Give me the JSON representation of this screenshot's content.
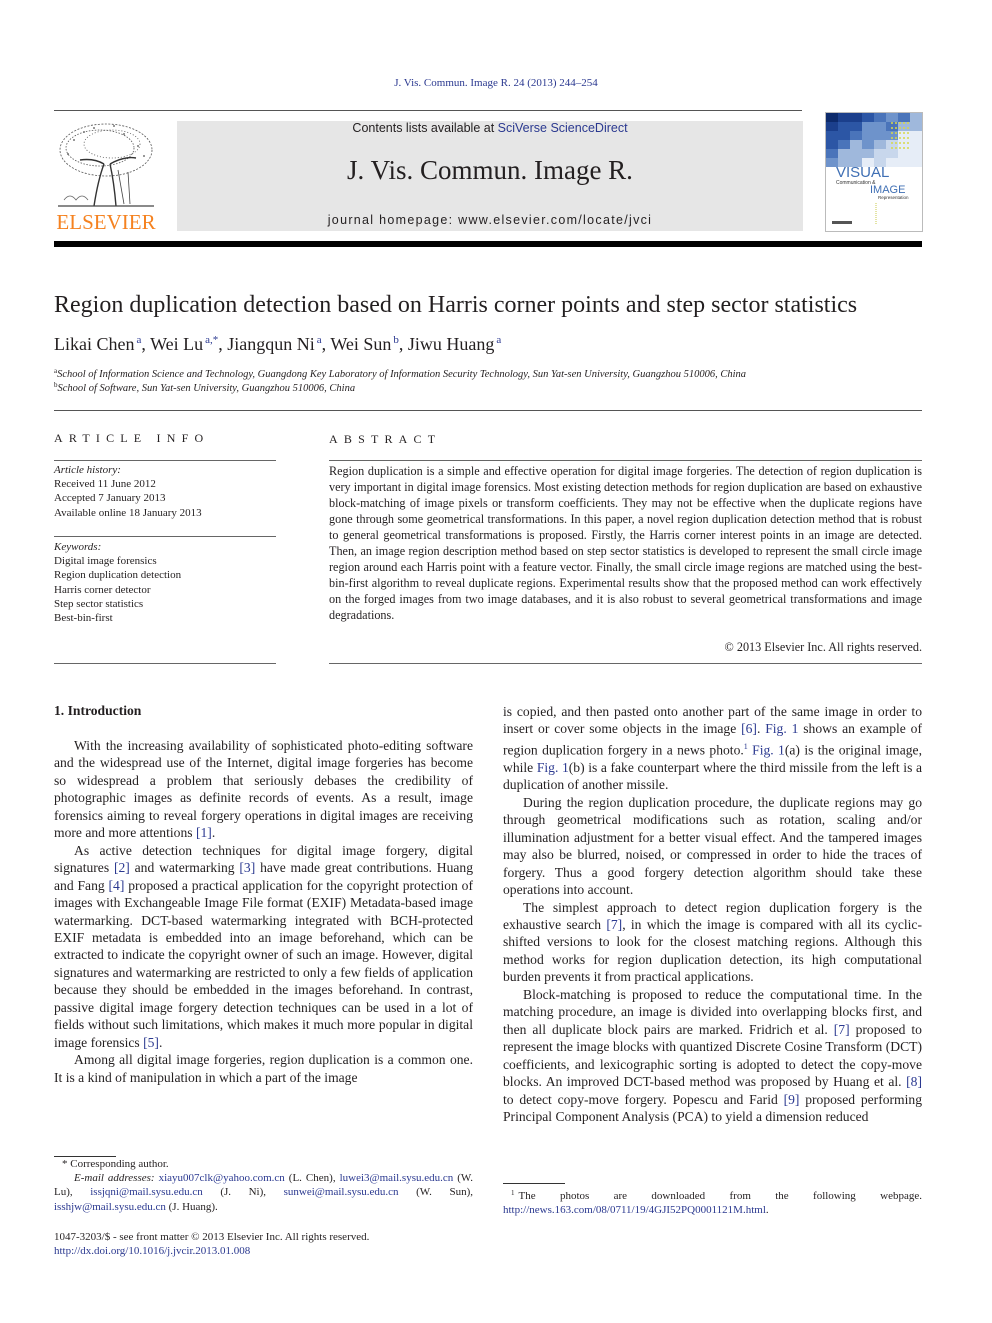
{
  "header": {
    "citation": "J. Vis. Commun. Image R. 24 (2013) 244–254",
    "contents_prefix": "Contents lists available at ",
    "contents_link": "SciVerse ScienceDirect",
    "journal_title": "J. Vis. Commun. Image R.",
    "homepage": "journal homepage: www.elsevier.com/locate/jvci",
    "publisher_wordmark": "ELSEVIER",
    "publisher_color": "#f58220",
    "link_color": "#2b3990",
    "cover": {
      "line1": "VISUAL",
      "line2": "Communication &",
      "line3": "IMAGE",
      "line4": "Representation"
    }
  },
  "article": {
    "title": "Region duplication detection based on Harris corner points and step sector statistics",
    "authors": [
      {
        "name": "Likai Chen",
        "affil": "a",
        "sep": ", "
      },
      {
        "name": "Wei Lu",
        "affil": "a,*",
        "sep": ", "
      },
      {
        "name": "Jiangqun Ni",
        "affil": "a",
        "sep": ", "
      },
      {
        "name": "Wei Sun",
        "affil": "b",
        "sep": ", "
      },
      {
        "name": "Jiwu Huang",
        "affil": "a",
        "sep": ""
      }
    ],
    "affiliations": [
      {
        "key": "a",
        "text": "School of Information Science and Technology, Guangdong Key Laboratory of Information Security Technology, Sun Yat-sen University, Guangzhou 510006, China"
      },
      {
        "key": "b",
        "text": "School of Software, Sun Yat-sen University, Guangzhou 510006, China"
      }
    ]
  },
  "article_info": {
    "heading": "ARTICLE INFO",
    "history_label": "Article history:",
    "history": [
      "Received 11 June 2012",
      "Accepted 7 January 2013",
      "Available online 18 January 2013"
    ],
    "keywords_label": "Keywords:",
    "keywords": [
      "Digital image forensics",
      "Region duplication detection",
      "Harris corner detector",
      "Step sector statistics",
      "Best-bin-first"
    ]
  },
  "abstract": {
    "heading": "ABSTRACT",
    "text": "Region duplication is a simple and effective operation for digital image forgeries. The detection of region duplication is very important in digital image forensics. Most existing detection methods for region dupli­cation are based on exhaustive block-matching of image pixels or transform coefficients. They may not be effective when the duplicate regions have gone through some geometrical transformations. In this paper, a novel region duplication detection method that is robust to general geometrical transformations is pro­posed. Firstly, the Harris corner interest points in an image are detected. Then, an image region descrip­tion method based on step sector statistics is developed to represent the small circle image region around each Harris point with a feature vector. Finally, the small circle image regions are matched using the best-bin-first algorithm to reveal duplicate regions. Experimental results show that the proposed method can work effectively on the forged images from two image databases, and it is also robust to several geomet­rical transformations and image degradations.",
    "copyright": "© 2013 Elsevier Inc. All rights reserved."
  },
  "body": {
    "section_heading": "1. Introduction",
    "left_paragraphs": [
      [
        {
          "t": "With the increasing availability of sophisticated photo-editing software and the widespread use of the Internet, digital image forgeries has become so widespread a problem that seriously de­bases the credibility of photographic images as definite records of events. As a result, image forensics aiming to reveal forgery operations in digital images are receiving more and more atten­tions "
        },
        {
          "ref": "[1]"
        },
        {
          "t": "."
        }
      ],
      [
        {
          "t": "As active detection techniques for digital image forgery, digital signatures "
        },
        {
          "ref": "[2]"
        },
        {
          "t": " and watermarking "
        },
        {
          "ref": "[3]"
        },
        {
          "t": " have made great contribu­tions. Huang and Fang "
        },
        {
          "ref": "[4]"
        },
        {
          "t": " proposed a practical application for the copyright protection of images with Exchangeable Image File format (EXIF) Metadata-based image watermarking. DCT-based watermarking integrated with BCH-protected EXIF metadata is embedded into an image beforehand, which can be extracted to indicate the copyright owner of such an image. However, digital signatures and watermarking are restricted to only a few fields of application because they should be embedded in the images beforehand. In contrast, passive digital image forgery detection techniques can be used in a lot of fields without such limitations, which makes it much more popular in digital image forensics "
        },
        {
          "ref": "[5]"
        },
        {
          "t": "."
        }
      ],
      [
        {
          "t": "Among all digital image forgeries, region duplication is a com­mon one. It is a kind of manipulation in which a part of the image"
        }
      ]
    ],
    "right_paragraphs": [
      [
        {
          "t": "is copied, and then pasted onto another part of the same image in order to insert or cover some objects in the image "
        },
        {
          "ref": "[6]"
        },
        {
          "t": ". "
        },
        {
          "ref": "Fig. 1"
        },
        {
          "t": " shows an example of region duplication forgery in a news photo."
        },
        {
          "sup": "1"
        },
        {
          "t": " "
        },
        {
          "ref": "Fig. 1"
        },
        {
          "t": "(a) is the original image, while "
        },
        {
          "ref": "Fig. 1"
        },
        {
          "t": "(b) is a fake counterpart where the third missile from the left is a duplication of another missile."
        }
      ],
      [
        {
          "t": "During the region duplication procedure, the duplicate regions may go through geometrical modifications such as rotation, scaling and/or illumination adjustment for a better visual effect. And the tampered images may also be blurred, noised, or compressed in or­der to hide the traces of forgery. Thus a good forgery detection algorithm should take these operations into account."
        }
      ],
      [
        {
          "t": "The simplest approach to detect region duplication forgery is the exhaustive search "
        },
        {
          "ref": "[7]"
        },
        {
          "t": ", in which the image is compared with all its cyclic-shifted versions to look for the closest matching regions. Although this method works for region duplication detec­tion, its high computational burden prevents it from practical applications."
        }
      ],
      [
        {
          "t": "Block-matching is proposed to reduce the computational time. In the matching procedure, an image is divided into overlapping blocks first, and then all duplicate block pairs are marked. Fridrich et al. "
        },
        {
          "ref": "[7]"
        },
        {
          "t": " proposed to represent the image blocks with quantized Discrete Cosine Transform (DCT) coefficients, and lexicographic sorting is adopted to detect the copy-move blocks. An improved DCT-based method was proposed by Huang et al. "
        },
        {
          "ref": "[8]"
        },
        {
          "t": " to detect copy-move forgery. Popescu and Farid "
        },
        {
          "ref": "[9]"
        },
        {
          "t": " proposed performing Principal Component Analysis (PCA) to yield a dimension reduced"
        }
      ]
    ]
  },
  "footnotes": {
    "corresponding": "* Corresponding author.",
    "email_label": "E-mail addresses:",
    "emails": [
      {
        "addr": "xiayu007clk@yahoo.com.cn",
        "who": "(L. Chen)"
      },
      {
        "addr": "luwei3@mail.sysu.edu.cn",
        "who": "(W. Lu)"
      },
      {
        "addr": "issjqni@mail.sysu.edu.cn",
        "who": "(J. Ni)"
      },
      {
        "addr": "sunwei@mail.sysu.edu.cn",
        "who": "(W. Sun)"
      },
      {
        "addr": "isshjw@mail.sysu.edu.cn",
        "who": "(J. Huang)."
      }
    ],
    "fn1_mark": "1",
    "fn1_text": "The photos are downloaded from the following webpage. ",
    "fn1_link": "http://news.163.com/08/0711/19/4GJI52PQ0001121M.html",
    "fn1_end": "."
  },
  "front_matter": {
    "issn_line": "1047-3203/$ - see front matter © 2013 Elsevier Inc. All rights reserved.",
    "doi": "http://dx.doi.org/10.1016/j.jvcir.2013.01.008"
  }
}
